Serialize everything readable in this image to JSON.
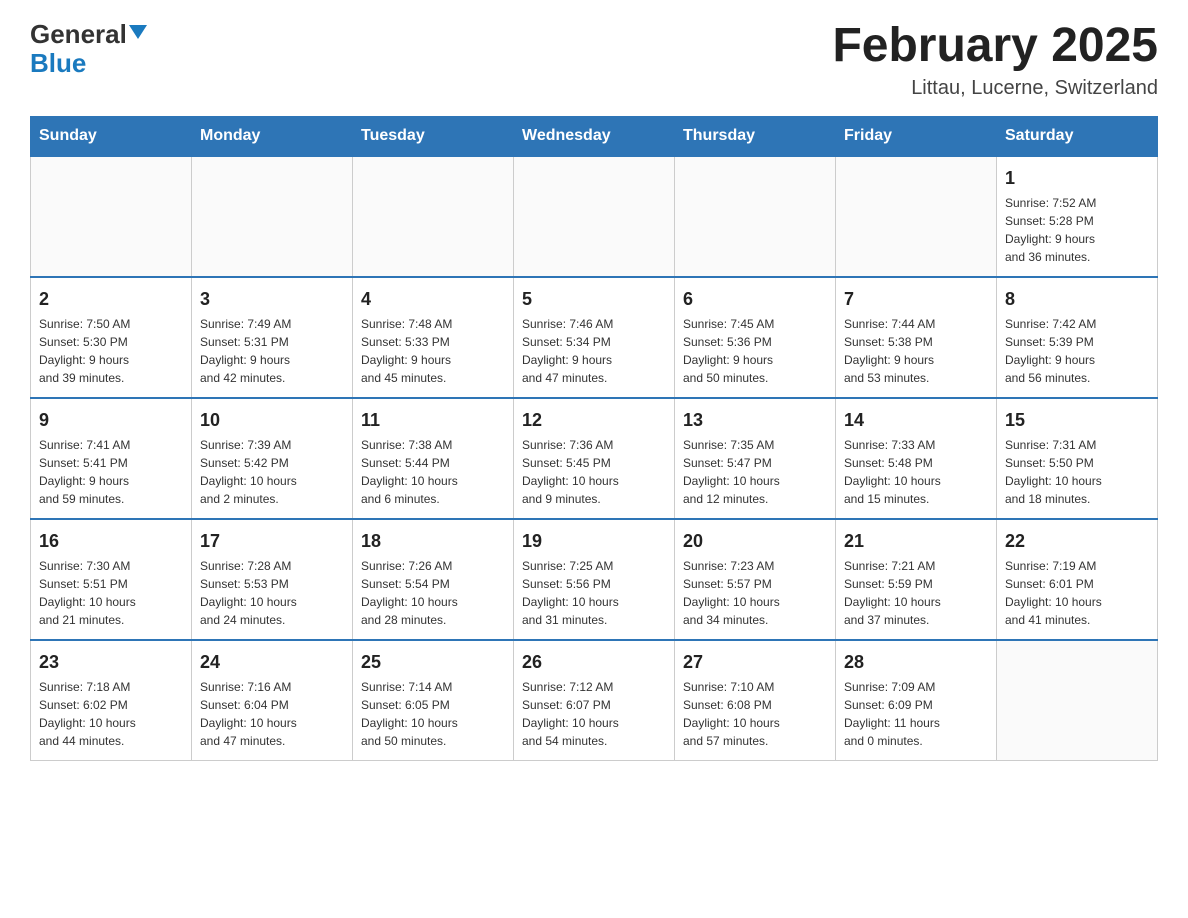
{
  "header": {
    "logo": {
      "general": "General",
      "blue": "Blue"
    },
    "title": "February 2025",
    "subtitle": "Littau, Lucerne, Switzerland"
  },
  "days_of_week": [
    "Sunday",
    "Monday",
    "Tuesday",
    "Wednesday",
    "Thursday",
    "Friday",
    "Saturday"
  ],
  "weeks": [
    [
      {
        "day": "",
        "info": ""
      },
      {
        "day": "",
        "info": ""
      },
      {
        "day": "",
        "info": ""
      },
      {
        "day": "",
        "info": ""
      },
      {
        "day": "",
        "info": ""
      },
      {
        "day": "",
        "info": ""
      },
      {
        "day": "1",
        "info": "Sunrise: 7:52 AM\nSunset: 5:28 PM\nDaylight: 9 hours\nand 36 minutes."
      }
    ],
    [
      {
        "day": "2",
        "info": "Sunrise: 7:50 AM\nSunset: 5:30 PM\nDaylight: 9 hours\nand 39 minutes."
      },
      {
        "day": "3",
        "info": "Sunrise: 7:49 AM\nSunset: 5:31 PM\nDaylight: 9 hours\nand 42 minutes."
      },
      {
        "day": "4",
        "info": "Sunrise: 7:48 AM\nSunset: 5:33 PM\nDaylight: 9 hours\nand 45 minutes."
      },
      {
        "day": "5",
        "info": "Sunrise: 7:46 AM\nSunset: 5:34 PM\nDaylight: 9 hours\nand 47 minutes."
      },
      {
        "day": "6",
        "info": "Sunrise: 7:45 AM\nSunset: 5:36 PM\nDaylight: 9 hours\nand 50 minutes."
      },
      {
        "day": "7",
        "info": "Sunrise: 7:44 AM\nSunset: 5:38 PM\nDaylight: 9 hours\nand 53 minutes."
      },
      {
        "day": "8",
        "info": "Sunrise: 7:42 AM\nSunset: 5:39 PM\nDaylight: 9 hours\nand 56 minutes."
      }
    ],
    [
      {
        "day": "9",
        "info": "Sunrise: 7:41 AM\nSunset: 5:41 PM\nDaylight: 9 hours\nand 59 minutes."
      },
      {
        "day": "10",
        "info": "Sunrise: 7:39 AM\nSunset: 5:42 PM\nDaylight: 10 hours\nand 2 minutes."
      },
      {
        "day": "11",
        "info": "Sunrise: 7:38 AM\nSunset: 5:44 PM\nDaylight: 10 hours\nand 6 minutes."
      },
      {
        "day": "12",
        "info": "Sunrise: 7:36 AM\nSunset: 5:45 PM\nDaylight: 10 hours\nand 9 minutes."
      },
      {
        "day": "13",
        "info": "Sunrise: 7:35 AM\nSunset: 5:47 PM\nDaylight: 10 hours\nand 12 minutes."
      },
      {
        "day": "14",
        "info": "Sunrise: 7:33 AM\nSunset: 5:48 PM\nDaylight: 10 hours\nand 15 minutes."
      },
      {
        "day": "15",
        "info": "Sunrise: 7:31 AM\nSunset: 5:50 PM\nDaylight: 10 hours\nand 18 minutes."
      }
    ],
    [
      {
        "day": "16",
        "info": "Sunrise: 7:30 AM\nSunset: 5:51 PM\nDaylight: 10 hours\nand 21 minutes."
      },
      {
        "day": "17",
        "info": "Sunrise: 7:28 AM\nSunset: 5:53 PM\nDaylight: 10 hours\nand 24 minutes."
      },
      {
        "day": "18",
        "info": "Sunrise: 7:26 AM\nSunset: 5:54 PM\nDaylight: 10 hours\nand 28 minutes."
      },
      {
        "day": "19",
        "info": "Sunrise: 7:25 AM\nSunset: 5:56 PM\nDaylight: 10 hours\nand 31 minutes."
      },
      {
        "day": "20",
        "info": "Sunrise: 7:23 AM\nSunset: 5:57 PM\nDaylight: 10 hours\nand 34 minutes."
      },
      {
        "day": "21",
        "info": "Sunrise: 7:21 AM\nSunset: 5:59 PM\nDaylight: 10 hours\nand 37 minutes."
      },
      {
        "day": "22",
        "info": "Sunrise: 7:19 AM\nSunset: 6:01 PM\nDaylight: 10 hours\nand 41 minutes."
      }
    ],
    [
      {
        "day": "23",
        "info": "Sunrise: 7:18 AM\nSunset: 6:02 PM\nDaylight: 10 hours\nand 44 minutes."
      },
      {
        "day": "24",
        "info": "Sunrise: 7:16 AM\nSunset: 6:04 PM\nDaylight: 10 hours\nand 47 minutes."
      },
      {
        "day": "25",
        "info": "Sunrise: 7:14 AM\nSunset: 6:05 PM\nDaylight: 10 hours\nand 50 minutes."
      },
      {
        "day": "26",
        "info": "Sunrise: 7:12 AM\nSunset: 6:07 PM\nDaylight: 10 hours\nand 54 minutes."
      },
      {
        "day": "27",
        "info": "Sunrise: 7:10 AM\nSunset: 6:08 PM\nDaylight: 10 hours\nand 57 minutes."
      },
      {
        "day": "28",
        "info": "Sunrise: 7:09 AM\nSunset: 6:09 PM\nDaylight: 11 hours\nand 0 minutes."
      },
      {
        "day": "",
        "info": ""
      }
    ]
  ]
}
